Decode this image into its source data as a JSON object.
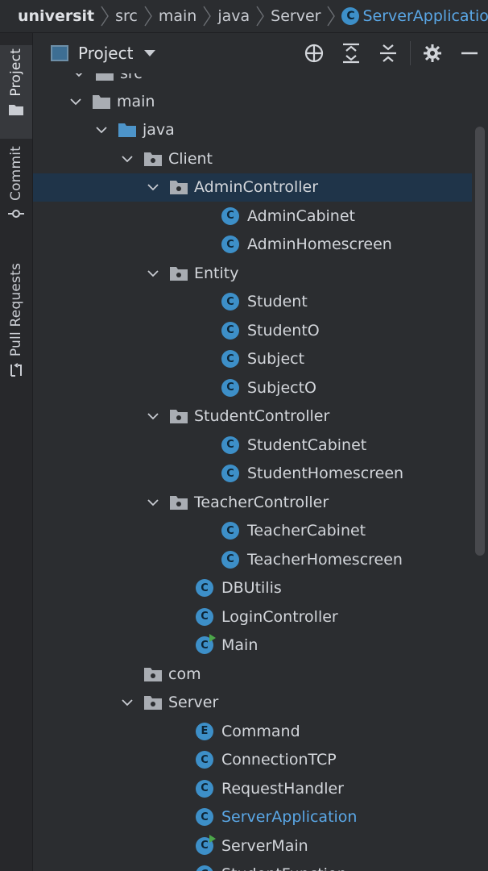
{
  "breadcrumb": {
    "items": [
      "universit",
      "src",
      "main",
      "java",
      "Server",
      "ServerApplication"
    ],
    "last_badge": "C"
  },
  "tool_strip": {
    "project": "Project",
    "commit": "Commit",
    "pull_requests": "Pull Requests"
  },
  "panel": {
    "title": "Project"
  },
  "tree": {
    "partial_top": "src",
    "rows": [
      {
        "label": "main",
        "kind": "folder",
        "expanded": true
      },
      {
        "label": "java",
        "kind": "folder-blue",
        "expanded": true
      },
      {
        "label": "Client",
        "kind": "package",
        "expanded": true
      },
      {
        "label": "AdminController",
        "kind": "package",
        "expanded": true,
        "selected": true
      },
      {
        "label": "AdminCabinet",
        "kind": "class",
        "badge": "C"
      },
      {
        "label": "AdminHomescreen",
        "kind": "class",
        "badge": "C"
      },
      {
        "label": "Entity",
        "kind": "package",
        "expanded": true
      },
      {
        "label": "Student",
        "kind": "class",
        "badge": "C"
      },
      {
        "label": "StudentO",
        "kind": "class",
        "badge": "C"
      },
      {
        "label": "Subject",
        "kind": "class",
        "badge": "C"
      },
      {
        "label": "SubjectO",
        "kind": "class",
        "badge": "C"
      },
      {
        "label": "StudentController",
        "kind": "package",
        "expanded": true
      },
      {
        "label": "StudentCabinet",
        "kind": "class",
        "badge": "C"
      },
      {
        "label": "StudentHomescreen",
        "kind": "class",
        "badge": "C"
      },
      {
        "label": "TeacherController",
        "kind": "package",
        "expanded": true
      },
      {
        "label": "TeacherCabinet",
        "kind": "class",
        "badge": "C"
      },
      {
        "label": "TeacherHomescreen",
        "kind": "class",
        "badge": "C"
      },
      {
        "label": "DBUtilis",
        "kind": "class",
        "badge": "C"
      },
      {
        "label": "LoginController",
        "kind": "class",
        "badge": "C"
      },
      {
        "label": "Main",
        "kind": "class-run",
        "badge": "C"
      },
      {
        "label": "com",
        "kind": "package"
      },
      {
        "label": "Server",
        "kind": "package",
        "expanded": true
      },
      {
        "label": "Command",
        "kind": "enum",
        "badge": "E"
      },
      {
        "label": "ConnectionTCP",
        "kind": "class",
        "badge": "C"
      },
      {
        "label": "RequestHandler",
        "kind": "class",
        "badge": "C"
      },
      {
        "label": "ServerApplication",
        "kind": "class",
        "badge": "C",
        "highlight": true
      },
      {
        "label": "ServerMain",
        "kind": "class-run",
        "badge": "C"
      },
      {
        "label": "StudentFunction",
        "kind": "class",
        "badge": "C"
      }
    ]
  },
  "colors": {
    "accent": "#3d8fc8",
    "selection": "#1f3449",
    "link_blue": "#5aa7e6",
    "background": "#2b2d30"
  }
}
